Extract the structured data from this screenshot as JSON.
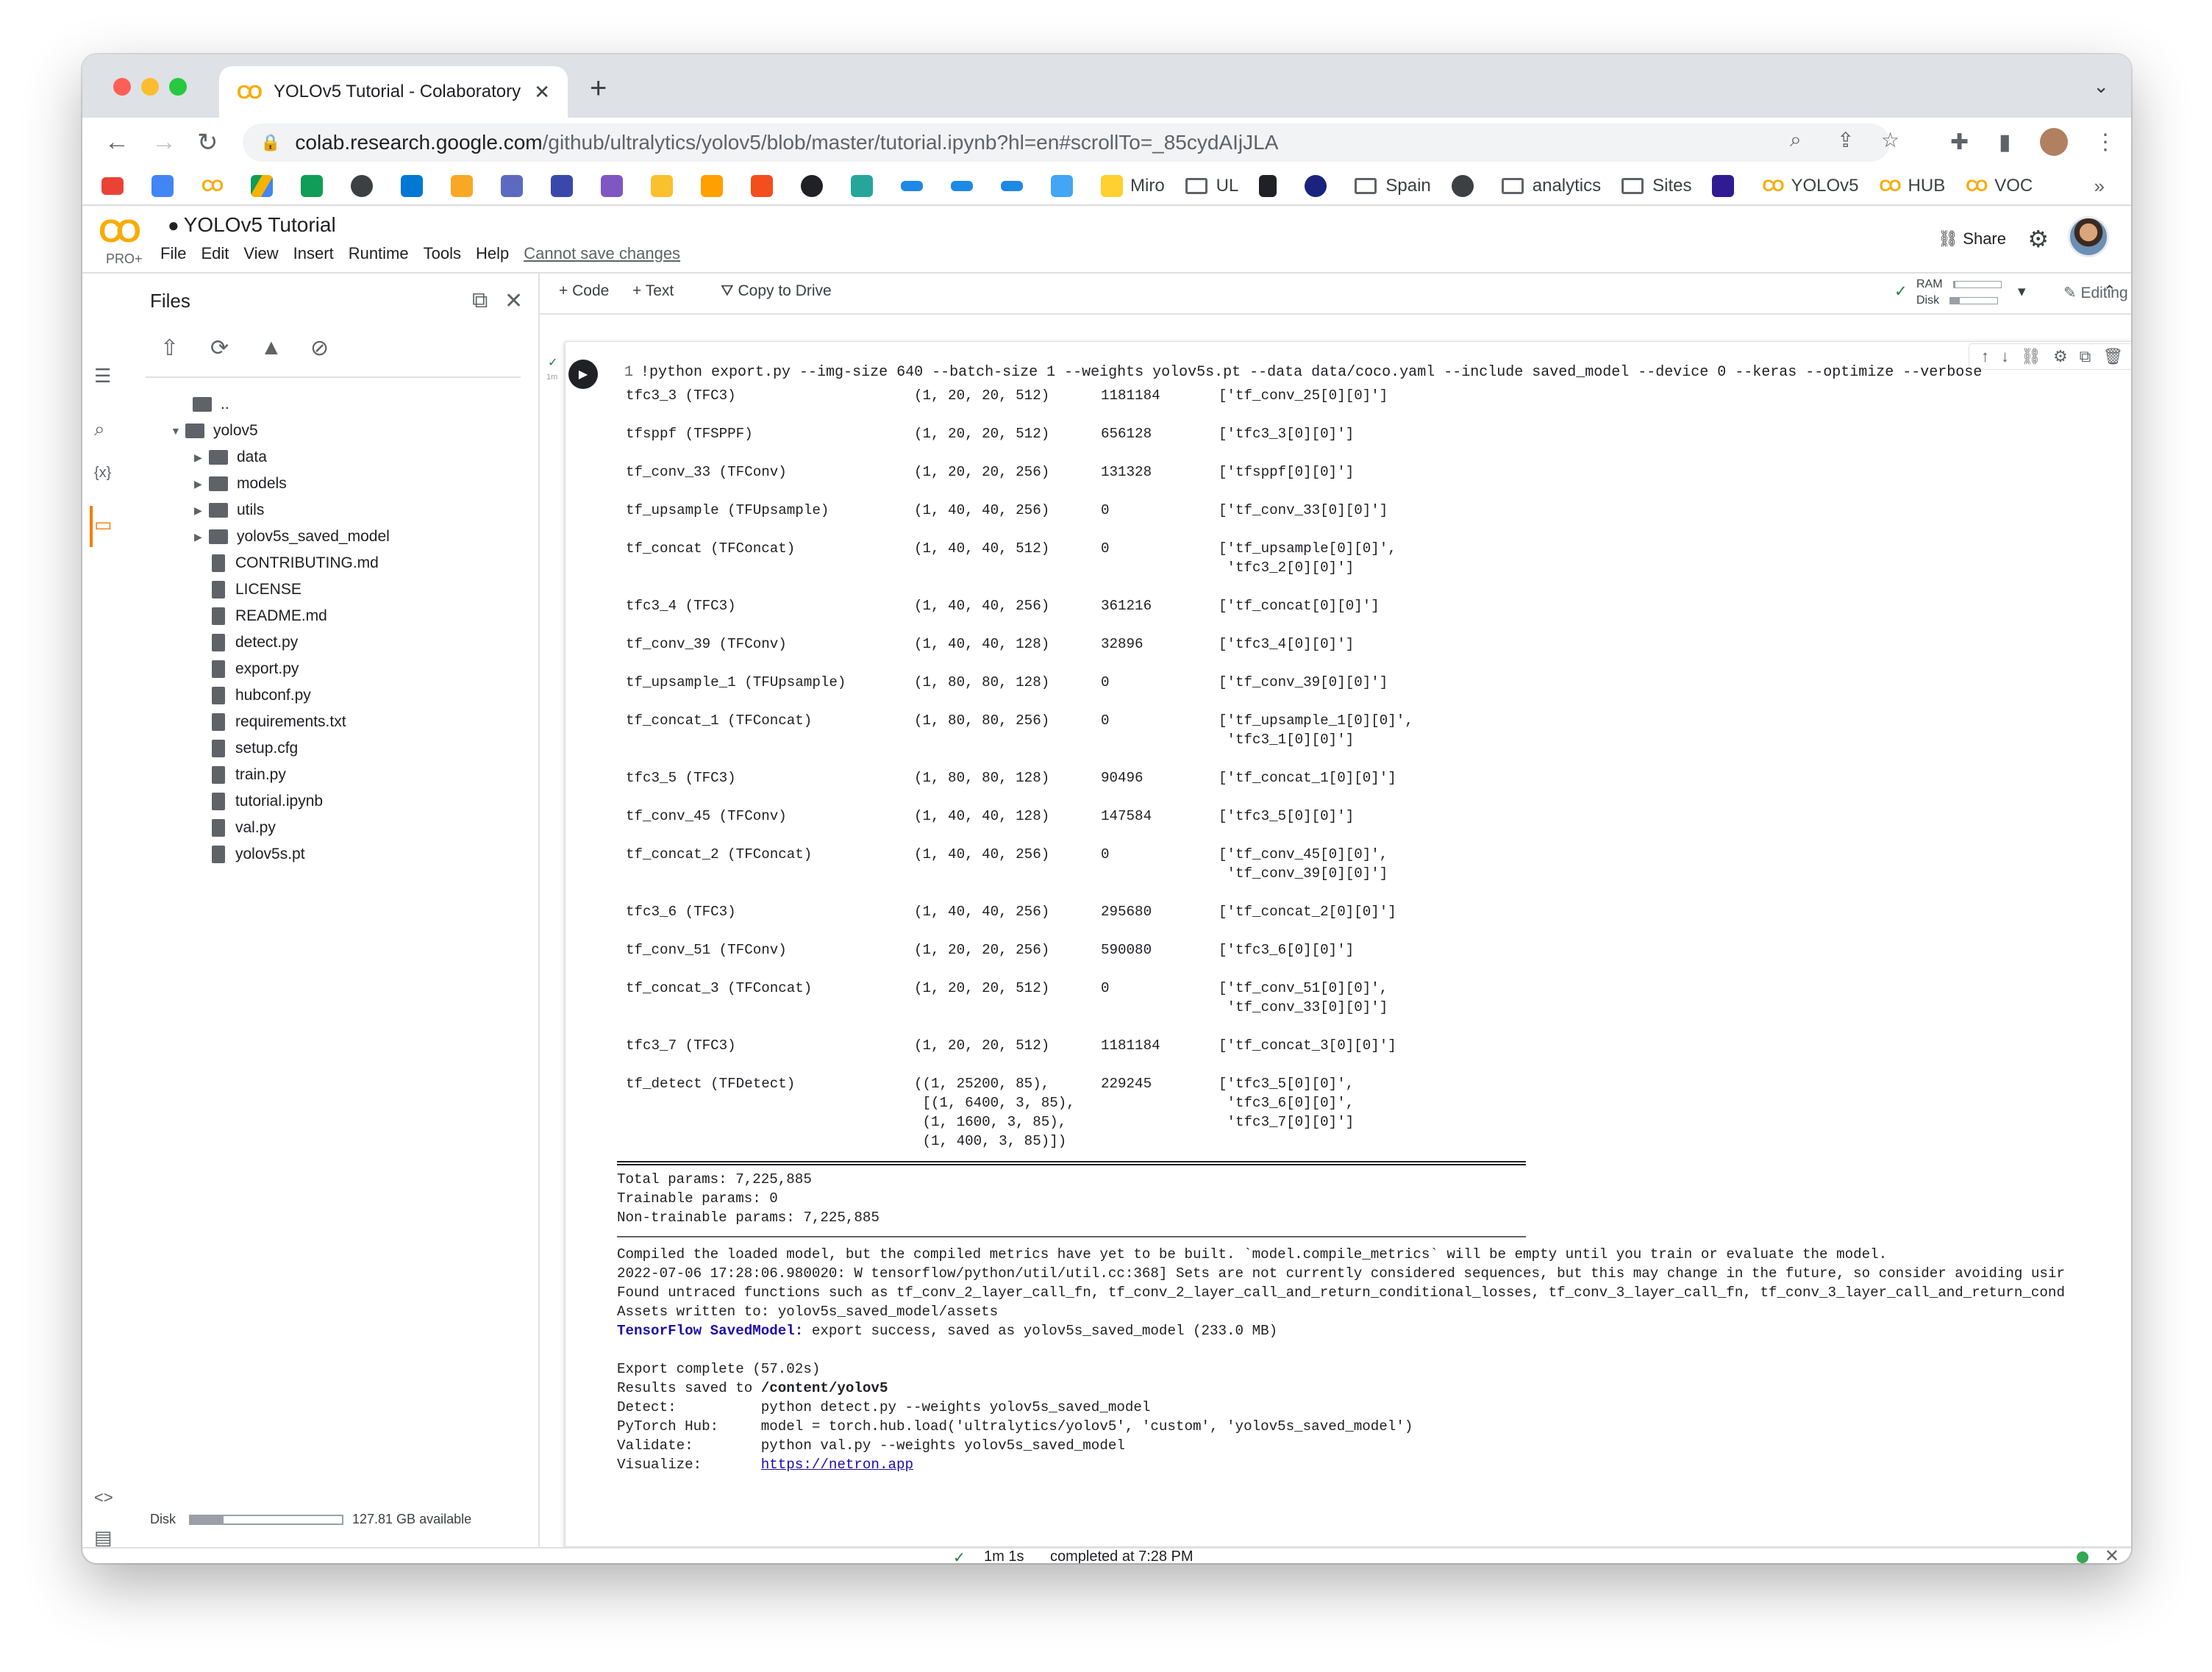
{
  "browser": {
    "tab_title": "YOLOv5 Tutorial - Colaboratory",
    "url_host": "colab.research.google.com",
    "url_path": "/github/ultralytics/yolov5/blob/master/tutorial.ipynb?hl=en#scrollTo=_85cydAIjJLA",
    "new_tab": "+",
    "bookmarks": [
      "Miro",
      "UL",
      "Spain",
      "analytics",
      "Sites",
      "YOLOv5",
      "HUB",
      "VOC"
    ],
    "bookmarks_more": "»"
  },
  "colab": {
    "logo": "CO",
    "tier": "PRO+",
    "notebook_title": "YOLOv5 Tutorial",
    "menu": [
      "File",
      "Edit",
      "View",
      "Insert",
      "Runtime",
      "Tools",
      "Help"
    ],
    "save_warning": "Cannot save changes",
    "share": "Share",
    "toolbar": {
      "code": "+ Code",
      "text": "+ Text",
      "copy": "Copy to Drive",
      "ram": "RAM",
      "disk": "Disk",
      "editing": "Editing"
    }
  },
  "files_panel": {
    "title": "Files",
    "parent": "..",
    "root": "yolov5",
    "folders": [
      "data",
      "models",
      "utils",
      "yolov5s_saved_model"
    ],
    "files": [
      "CONTRIBUTING.md",
      "LICENSE",
      "README.md",
      "detect.py",
      "export.py",
      "hubconf.py",
      "requirements.txt",
      "setup.cfg",
      "train.py",
      "tutorial.ipynb",
      "val.py",
      "yolov5s.pt"
    ],
    "disk_label": "Disk",
    "disk_available": "127.81 GB available",
    "disk_used_fraction": 0.22
  },
  "cell": {
    "line_number": "1",
    "command": "!python export.py --img-size 640 --batch-size 1 --weights yolov5s.pt --data data/coco.yaml --include saved_model --device 0 --keras --optimize --verbose",
    "exec_time": "1m"
  },
  "output": {
    "layers": [
      {
        "name": "tfc3_3 (TFC3)",
        "shape": "(1, 20, 20, 512)",
        "params": "1181184",
        "inputs": "['tf_conv_25[0][0]']"
      },
      {
        "name": "tfsppf (TFSPPF)",
        "shape": "(1, 20, 20, 512)",
        "params": "656128",
        "inputs": "['tfc3_3[0][0]']"
      },
      {
        "name": "tf_conv_33 (TFConv)",
        "shape": "(1, 20, 20, 256)",
        "params": "131328",
        "inputs": "['tfsppf[0][0]']"
      },
      {
        "name": "tf_upsample (TFUpsample)",
        "shape": "(1, 40, 40, 256)",
        "params": "0",
        "inputs": "['tf_conv_33[0][0]']"
      },
      {
        "name": "tf_concat (TFConcat)",
        "shape": "(1, 40, 40, 512)",
        "params": "0",
        "inputs": "['tf_upsample[0][0]',",
        "inputs2": " 'tfc3_2[0][0]']"
      },
      {
        "name": "tfc3_4 (TFC3)",
        "shape": "(1, 40, 40, 256)",
        "params": "361216",
        "inputs": "['tf_concat[0][0]']"
      },
      {
        "name": "tf_conv_39 (TFConv)",
        "shape": "(1, 40, 40, 128)",
        "params": "32896",
        "inputs": "['tfc3_4[0][0]']"
      },
      {
        "name": "tf_upsample_1 (TFUpsample)",
        "shape": "(1, 80, 80, 128)",
        "params": "0",
        "inputs": "['tf_conv_39[0][0]']"
      },
      {
        "name": "tf_concat_1 (TFConcat)",
        "shape": "(1, 80, 80, 256)",
        "params": "0",
        "inputs": "['tf_upsample_1[0][0]',",
        "inputs2": " 'tfc3_1[0][0]']"
      },
      {
        "name": "tfc3_5 (TFC3)",
        "shape": "(1, 80, 80, 128)",
        "params": "90496",
        "inputs": "['tf_concat_1[0][0]']"
      },
      {
        "name": "tf_conv_45 (TFConv)",
        "shape": "(1, 40, 40, 128)",
        "params": "147584",
        "inputs": "['tfc3_5[0][0]']"
      },
      {
        "name": "tf_concat_2 (TFConcat)",
        "shape": "(1, 40, 40, 256)",
        "params": "0",
        "inputs": "['tf_conv_45[0][0]',",
        "inputs2": " 'tf_conv_39[0][0]']"
      },
      {
        "name": "tfc3_6 (TFC3)",
        "shape": "(1, 40, 40, 256)",
        "params": "295680",
        "inputs": "['tf_concat_2[0][0]']"
      },
      {
        "name": "tf_conv_51 (TFConv)",
        "shape": "(1, 20, 20, 256)",
        "params": "590080",
        "inputs": "['tfc3_6[0][0]']"
      },
      {
        "name": "tf_concat_3 (TFConcat)",
        "shape": "(1, 20, 20, 512)",
        "params": "0",
        "inputs": "['tf_conv_51[0][0]',",
        "inputs2": " 'tf_conv_33[0][0]']"
      },
      {
        "name": "tfc3_7 (TFC3)",
        "shape": "(1, 20, 20, 512)",
        "params": "1181184",
        "inputs": "['tf_concat_3[0][0]']"
      }
    ],
    "detect": {
      "name": "tf_detect (TFDetect)",
      "shape": [
        "((1, 25200, 85),",
        " [(1, 6400, 3, 85),",
        " (1, 1600, 3, 85),",
        " (1, 400, 3, 85)])"
      ],
      "params": "229245",
      "inputs": [
        "['tfc3_5[0][0]',",
        " 'tfc3_6[0][0]',",
        " 'tfc3_7[0][0]']"
      ]
    },
    "total_params": "Total params: 7,225,885",
    "trainable_params": "Trainable params: 0",
    "non_trainable_params": "Non-trainable params: 7,225,885",
    "log": [
      "Compiled the loaded model, but the compiled metrics have yet to be built. `model.compile_metrics` will be empty until you train or evaluate the model.",
      "2022-07-06 17:28:06.980020: W tensorflow/python/util/util.cc:368] Sets are not currently considered sequences, but this may change in the future, so consider avoiding usir",
      "Found untraced functions such as tf_conv_2_layer_call_fn, tf_conv_2_layer_call_and_return_conditional_losses, tf_conv_3_layer_call_fn, tf_conv_3_layer_call_and_return_cond",
      "Assets written to: yolov5s_saved_model/assets"
    ],
    "saved_label": "TensorFlow SavedModel:",
    "saved_text": " export success, saved as yolov5s_saved_model (233.0 MB)",
    "complete": "Export complete (57.02s)",
    "results_prefix": "Results saved to ",
    "results_path": "/content/yolov5",
    "detect_line": "Detect:          python detect.py --weights yolov5s_saved_model",
    "hub_line": "PyTorch Hub:     model = torch.hub.load('ultralytics/yolov5', 'custom', 'yolov5s_saved_model')",
    "validate_line": "Validate:        python val.py --weights yolov5s_saved_model",
    "visualize_prefix": "Visualize:       ",
    "visualize_link": "https://netron.app"
  },
  "status": {
    "duration": "1m 1s",
    "completed": "completed at 7:28 PM"
  }
}
